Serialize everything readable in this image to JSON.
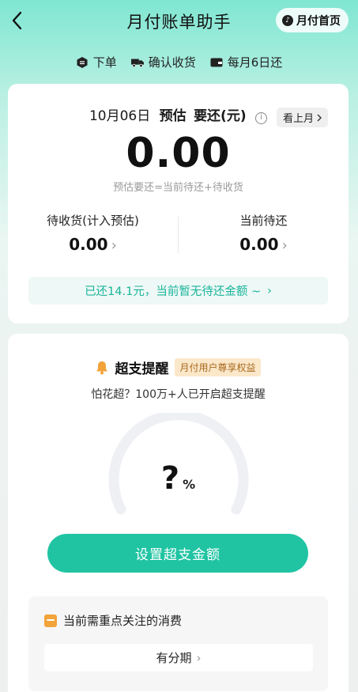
{
  "nav": {
    "title": "月付账单助手",
    "home_label": "月付首页",
    "home_icon": "tiktok-logo-icon",
    "back_icon": "back-chevron-icon"
  },
  "steps": [
    {
      "icon": "order-icon",
      "label": "下单"
    },
    {
      "icon": "truck-icon",
      "label": "确认收货"
    },
    {
      "icon": "wallet-icon",
      "label": "每月6日还"
    }
  ],
  "bill": {
    "date": "10月06日",
    "estimate_label": "预估",
    "due_label": "要还(元)",
    "info_icon": "info-icon",
    "last_month_label": "看上月",
    "amount": "0.00",
    "formula": "预估要还=当前待还+待收货",
    "pending_receipt_label": "待收货(计入预估)",
    "pending_receipt_value": "0.00",
    "current_due_label": "当前待还",
    "current_due_value": "0.00",
    "repaid_notice": "已还14.1元，当前暂无待还金额 ~"
  },
  "overspend": {
    "title": "超支提醒",
    "badge": "月付用户尊享权益",
    "subtitle": "怕花超？100万+人已开启超支提醒",
    "gauge_value": "?",
    "gauge_unit": "%",
    "button_label": "设置超支金额",
    "focus_title": "当前需重点关注的消费",
    "focus_item": "有分期"
  },
  "colors": {
    "accent": "#20c4a3",
    "accent_text": "#19b59a",
    "badge_bg": "#fbe7c9",
    "badge_text": "#a86a20",
    "bell": "#f2a33a"
  }
}
